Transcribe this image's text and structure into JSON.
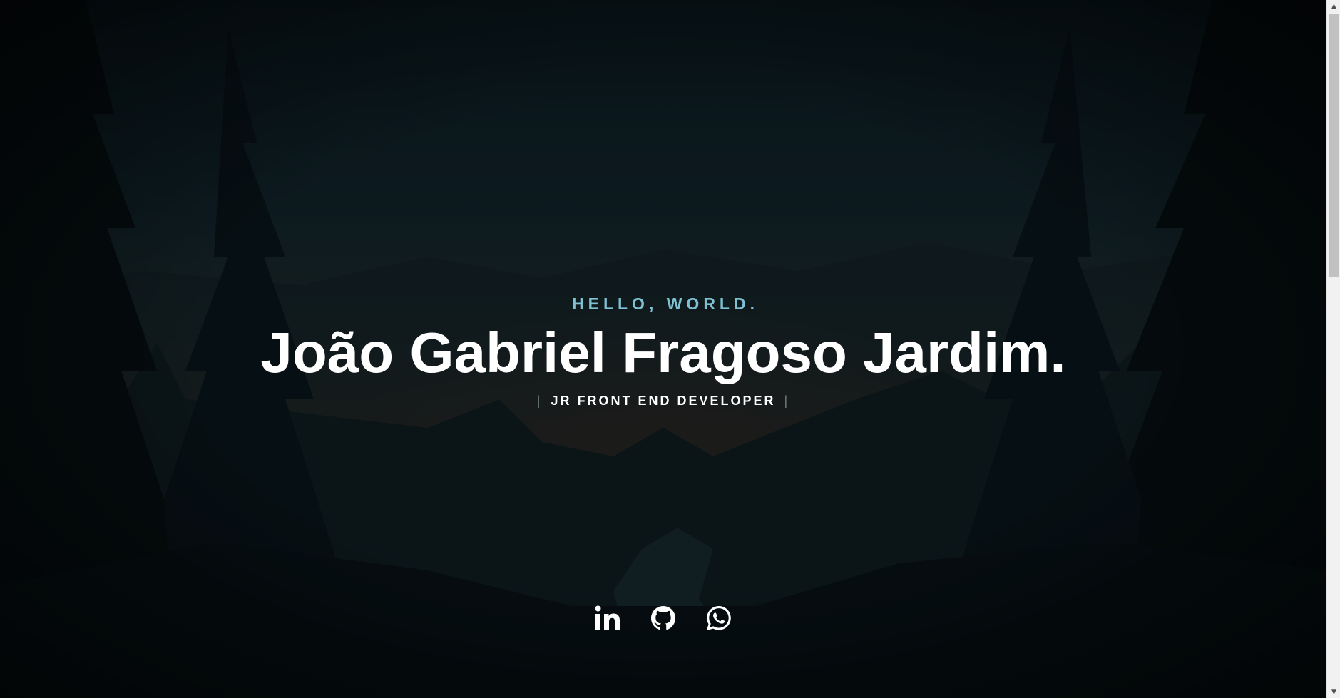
{
  "hero": {
    "greeting": "HELLO, WORLD.",
    "name": "João Gabriel Fragoso Jardim.",
    "role_prefix": "|",
    "role": "JR FRONT END DEVELOPER",
    "role_suffix": "|"
  },
  "social": [
    {
      "icon": "linkedin-icon"
    },
    {
      "icon": "github-icon"
    },
    {
      "icon": "whatsapp-icon"
    }
  ],
  "colors": {
    "accent": "#7fc1d3",
    "text": "#ffffff",
    "background": "#0c1a1f"
  },
  "scrollbar": {
    "up_glyph": "▲",
    "down_glyph": "▼"
  }
}
